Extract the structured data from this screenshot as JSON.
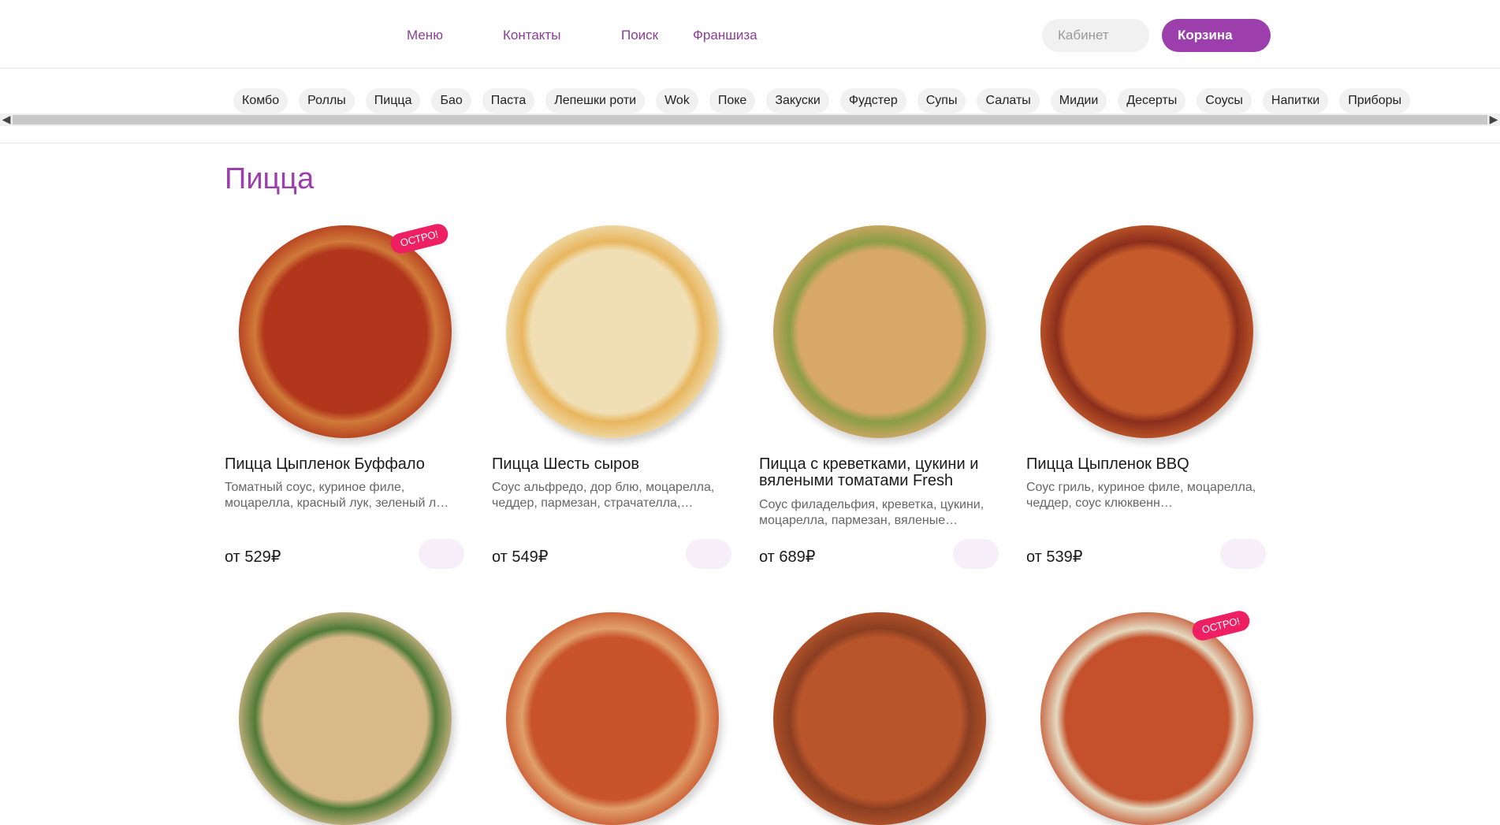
{
  "header": {
    "nav": [
      "Меню",
      "Контакты",
      "Поиск",
      "Франшиза"
    ],
    "cabinet_label": "Кабинет",
    "cart_label": "Корзина"
  },
  "categories": [
    "Комбо",
    "Роллы",
    "Пицца",
    "Бао",
    "Паста",
    "Лепешки роти",
    "Wok",
    "Поке",
    "Закуски",
    "Фудстер",
    "Супы",
    "Салаты",
    "Мидии",
    "Десерты",
    "Соусы",
    "Напитки",
    "Приборы"
  ],
  "scroll_icons": {
    "left": "arrow-left-icon",
    "right": "arrow-right-icon"
  },
  "section_title": "Пицца",
  "products": [
    {
      "title": "Пицца Цыпленок Буффало",
      "desc": "Томатный соус, куриное филе, моцарелла, красный лук, зеленый л…",
      "price": "от 529₽",
      "tag": "ОСТРО!",
      "colors": [
        "#b2361b",
        "#d07a3a",
        "#e3c08f"
      ]
    },
    {
      "title": "Пицца Шесть сыров",
      "desc": "Соус альфредо, дор блю, моцарелла, чеддер, пармезан, страчателла,…",
      "price": "от 549₽",
      "tag": "",
      "colors": [
        "#f0dfb4",
        "#e8b65e",
        "#e7c997"
      ]
    },
    {
      "title": "Пицца с креветками, цукини и вялеными томатами Fresh",
      "desc": "Соус филадельфия, креветка, цукини, моцарелла, пармезан, вяленые…",
      "price": "от 689₽",
      "tag": "",
      "colors": [
        "#d8a868",
        "#8a9d45",
        "#e4c692"
      ]
    },
    {
      "title": "Пицца Цыпленок BBQ",
      "desc": "Соус гриль, куриное филе, моцарелла, чеддер, соус клюквенн…",
      "price": "от 539₽",
      "tag": "",
      "colors": [
        "#c55b2a",
        "#8a2e1c",
        "#e3bf8d"
      ]
    },
    {
      "title": "",
      "desc": "",
      "price": "",
      "tag": "",
      "colors": [
        "#d9b98a",
        "#4f7b36",
        "#e8cfa0"
      ]
    },
    {
      "title": "",
      "desc": "",
      "price": "",
      "tag": "",
      "colors": [
        "#c9542b",
        "#e0a06a",
        "#e6c898"
      ]
    },
    {
      "title": "",
      "desc": "",
      "price": "",
      "tag": "",
      "colors": [
        "#b8552a",
        "#8a3e22",
        "#e3c08c"
      ]
    },
    {
      "title": "",
      "desc": "",
      "price": "",
      "tag": "ОСТРО!",
      "colors": [
        "#c4512b",
        "#e4d9c0",
        "#e6c592"
      ]
    }
  ],
  "colors": {
    "accent": "#9c3fac",
    "tag": "#ef1f63",
    "add_button": "#f6eef8"
  }
}
